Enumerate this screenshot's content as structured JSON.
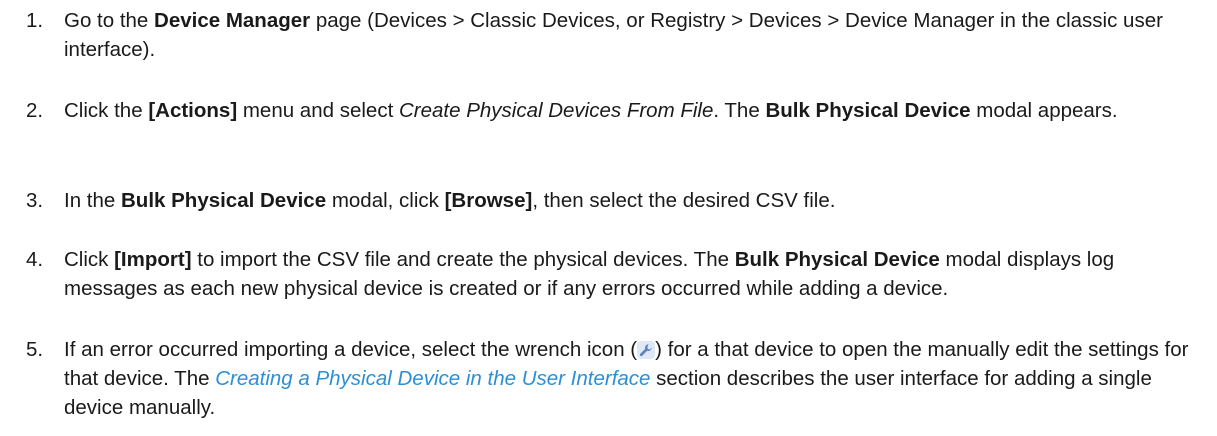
{
  "steps": [
    {
      "num": "1.",
      "parts": [
        "Go to the ",
        "Device Manager",
        " page (Devices > Classic Devices, or Registry > Devices > Device Manager in the classic user interface)."
      ]
    },
    {
      "num": "2.",
      "parts": [
        "Click the ",
        "[Actions]",
        " menu and select ",
        "Create Physical Devices From File",
        ". The ",
        "Bulk Physical Device",
        " modal appears."
      ]
    },
    {
      "num": "3.",
      "parts": [
        "In the ",
        "Bulk Physical Device",
        " modal, click ",
        "[Browse]",
        ", then select the desired CSV file."
      ]
    },
    {
      "num": "4.",
      "parts": [
        "Click ",
        "[Import]",
        " to import the CSV file and create the physical devices. The ",
        "Bulk Physical Device",
        " modal displays log messages as each new physical device is created or if any errors occurred while adding a device."
      ]
    },
    {
      "num": "5.",
      "parts": [
        "If an error occurred importing a device, select the wrench icon (",
        ") for a that device to open the manually edit the settings for that device. The ",
        "Creating a Physical Device in the User Interface",
        " section describes the user interface for adding a single device manually."
      ],
      "icon": "wrench-icon"
    }
  ],
  "colors": {
    "link": "#2a8fd6",
    "text": "#1a1a1a",
    "icon_bg": "#dfe9f6"
  }
}
